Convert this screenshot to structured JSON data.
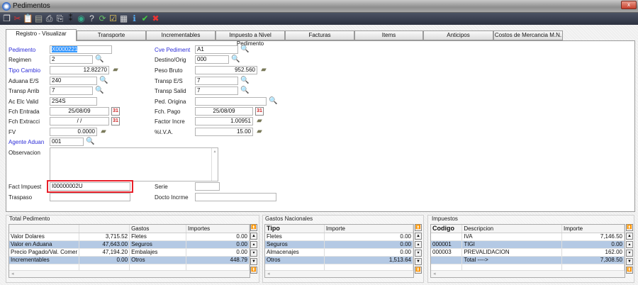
{
  "window": {
    "title": "Pedimentos",
    "close_label": "x"
  },
  "toolbar": {
    "icons": [
      "copy-icon",
      "cut-icon",
      "paste-icon",
      "calculator-icon",
      "print-icon",
      "print-preview-icon",
      "footprints-icon",
      "globe-icon",
      "help-icon",
      "refresh-icon",
      "checklist-icon",
      "document-icon",
      "info-icon",
      "accept-icon",
      "cancel-icon"
    ],
    "glyphs": [
      "❐",
      "✂",
      "📋",
      "▤",
      "⎙",
      "⎘",
      "⁑",
      "◉",
      "?",
      "⟳",
      "☑",
      "▦",
      "ℹ",
      "✔",
      "✖"
    ]
  },
  "tabs": [
    "Registro - Visualizar",
    "Transporte",
    "Incrementables",
    "Impuesto a Nivel Pedimento",
    "Facturas",
    "Items",
    "Anticipos",
    "Costos de Mercancia M.N."
  ],
  "form": {
    "pedimento": {
      "label": "Pedimento",
      "value": "X0000221"
    },
    "regimen": {
      "label": "Regimen",
      "value": "2"
    },
    "tipo_cambio": {
      "label": "Tipo Cambio",
      "value": "12.82270"
    },
    "aduana": {
      "label": "Aduana E/S",
      "value": "240"
    },
    "transp_arrib": {
      "label": "Transp Arrib",
      "value": "7"
    },
    "ac_elc": {
      "label": "Ac Elc Valid",
      "value": "2S4S"
    },
    "fch_entrada": {
      "label": "Fch Entrada",
      "value": "25/08/09"
    },
    "fch_extracci": {
      "label": "Fch Extracci",
      "value": "/ /"
    },
    "fv": {
      "label": "FV",
      "value": "0.0000"
    },
    "agente": {
      "label": "Agente Aduan",
      "value": "001"
    },
    "observacion": {
      "label": "Observacion",
      "value": ""
    },
    "fact_impuest": {
      "label": "Fact Impuest",
      "value": "I00000002U"
    },
    "traspaso": {
      "label": "Traspaso",
      "value": ""
    },
    "cve_pediment": {
      "label": "Cve Pediment",
      "value": "A1"
    },
    "destino": {
      "label": "Destino/Orig",
      "value": "000"
    },
    "peso_bruto": {
      "label": "Peso Bruto",
      "value": "952.560"
    },
    "transp_es": {
      "label": "Transp E/S",
      "value": "7"
    },
    "transp_salid": {
      "label": "Transp Salid",
      "value": "7"
    },
    "ped_origina": {
      "label": "Ped. Origina",
      "value": ""
    },
    "fch_pago": {
      "label": "Fch. Pago",
      "value": "25/08/09"
    },
    "factor": {
      "label": "Factor Incre",
      "value": "1.00951"
    },
    "iva": {
      "label": "%I.V.A.",
      "value": "15.00"
    },
    "serie": {
      "label": "Serie",
      "value": ""
    },
    "docto": {
      "label": "Docto Incrme",
      "value": ""
    }
  },
  "total_pedimento": {
    "title": "Total Pedimento",
    "headers": [
      "",
      "",
      "Gastos",
      "Importes"
    ],
    "rows": [
      [
        "Valor Dolares",
        "3,715.52",
        "Fletes",
        "0.00"
      ],
      [
        "Valor en Aduana",
        "47,643.00",
        "Seguros",
        "0.00"
      ],
      [
        "Precio Pagado/Val. Comer",
        "47,194.20",
        "Embalajes",
        "0.00"
      ],
      [
        "Incrementables",
        "0.00",
        "Otros",
        "448.79"
      ]
    ]
  },
  "gastos_nacionales": {
    "title": "Gastos Nacionales",
    "headers": [
      "Tipo",
      "Importe"
    ],
    "rows": [
      [
        "Fletes",
        "0.00"
      ],
      [
        "Seguros",
        "0.00"
      ],
      [
        "Almacenajes",
        "0.00"
      ],
      [
        "Otros",
        "1,513.64"
      ]
    ]
  },
  "impuestos": {
    "title": "Impuestos",
    "headers": [
      "Codigo",
      "Descripcion",
      "Importe"
    ],
    "rows": [
      [
        "",
        "IVA",
        "7,146.50"
      ],
      [
        "000001",
        "TIGI",
        "0.00"
      ],
      [
        "000003",
        "PREVALIDACION",
        "162.00"
      ],
      [
        "",
        "Total  ---->",
        "7,308.50"
      ]
    ]
  },
  "colors": {
    "highlight_row": "#b4c9e4",
    "required_label": "#2d2dd8",
    "focus_box": "#e8202a",
    "toolbar": "#2c3140"
  }
}
